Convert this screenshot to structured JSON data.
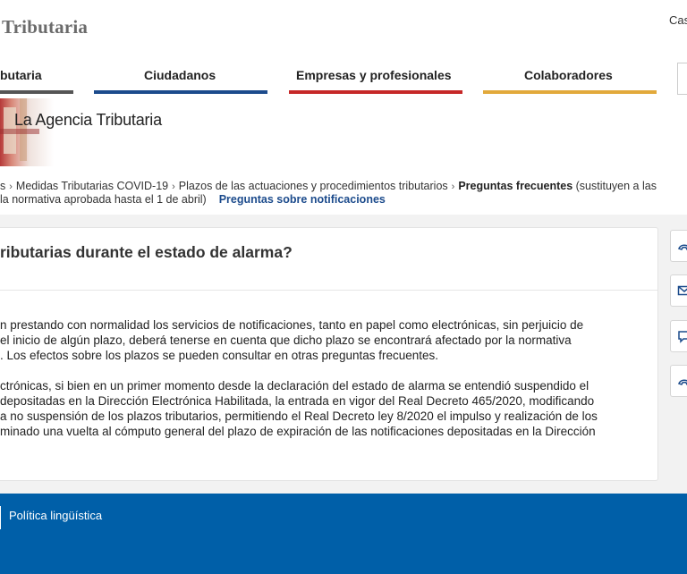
{
  "header": {
    "logo_text": "Tributaria",
    "lang_text": "Cas"
  },
  "nav": {
    "items": [
      {
        "label": "butaria",
        "color": "#555555"
      },
      {
        "label": "Ciudadanos",
        "color": "#1c4b8c"
      },
      {
        "label": "Empresas y profesionales",
        "color": "#c62828"
      },
      {
        "label": "Colaboradores",
        "color": "#e2a93b"
      }
    ]
  },
  "banner": {
    "title": "La Agencia Tributaria"
  },
  "breadcrumb": {
    "items": [
      "s",
      "Medidas Tributarias COVID-19",
      "Plazos de las actuaciones y procedimientos tributarios"
    ],
    "current": "Preguntas frecuentes",
    "current_note": "(sustituyen a las",
    "line2_text": "la normativa aprobada hasta el 1 de abril)",
    "line2_link": "Preguntas sobre notificaciones"
  },
  "content": {
    "question": "ributarias durante el estado de alarma?",
    "para1": [
      "n prestando con normalidad los servicios de notificaciones, tanto en papel como electrónicas, sin perjuicio de",
      "el inicio de algún plazo, deberá tenerse en cuenta que dicho plazo se encontrará afectado por la normativa",
      ". Los efectos sobre los plazos se pueden consultar en otras preguntas frecuentes."
    ],
    "para2": [
      "ctrónicas, si bien en un primer momento desde la declaración del estado de alarma se entendió suspendido el",
      "depositadas en la Dirección Electrónica Habilitada, la entrada en vigor del Real Decreto 465/2020, modificando",
      "a no suspensión de los plazos tributarios, permitiendo el Real Decreto ley 8/2020 el impulso y realización de los",
      "minado una vuelta al cómputo general del plazo de expiración de las notificaciones depositadas en la Dirección"
    ]
  },
  "side_icons": [
    "phone-icon",
    "mail-icon",
    "chat-icon",
    "phone-icon"
  ],
  "footer": {
    "link": "Política lingüística"
  }
}
